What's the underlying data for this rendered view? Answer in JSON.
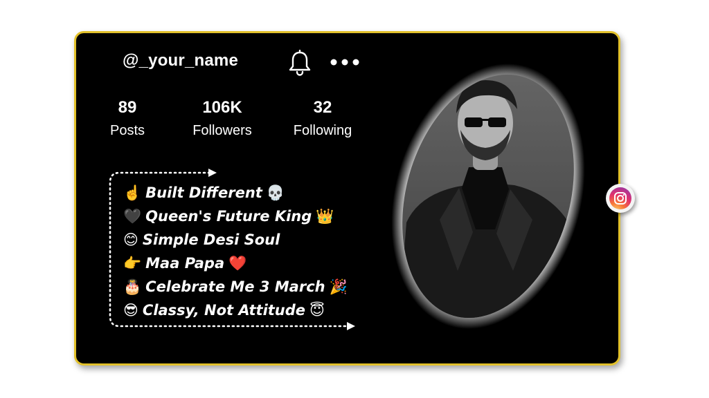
{
  "profile": {
    "username": "@_your_name",
    "stats": [
      {
        "value": "89",
        "label": "Posts"
      },
      {
        "value": "106K",
        "label": "Followers"
      },
      {
        "value": "32",
        "label": "Following"
      }
    ],
    "bio": [
      {
        "emoji": "☝️",
        "text": "Built Different",
        "emoji_after": "💀"
      },
      {
        "emoji": "🖤",
        "text": "Queen's Future King",
        "emoji_after": "👑"
      },
      {
        "emoji": "😊",
        "text": "Simple Desi Soul",
        "emoji_after": ""
      },
      {
        "emoji": "👉",
        "text": "Maa Papa",
        "emoji_after": "❤️"
      },
      {
        "emoji": "🎂",
        "text": "Celebrate Me 3 March",
        "emoji_after": "🎉"
      },
      {
        "emoji": "😎",
        "text": "Classy, Not Attitude",
        "emoji_after": "😇"
      }
    ]
  },
  "icons": {
    "notification": "bell-icon",
    "more": "more-options-icon",
    "brand": "instagram-icon"
  },
  "colors": {
    "card_background": "#000000",
    "card_border": "#e2c12b",
    "text": "#ffffff"
  }
}
